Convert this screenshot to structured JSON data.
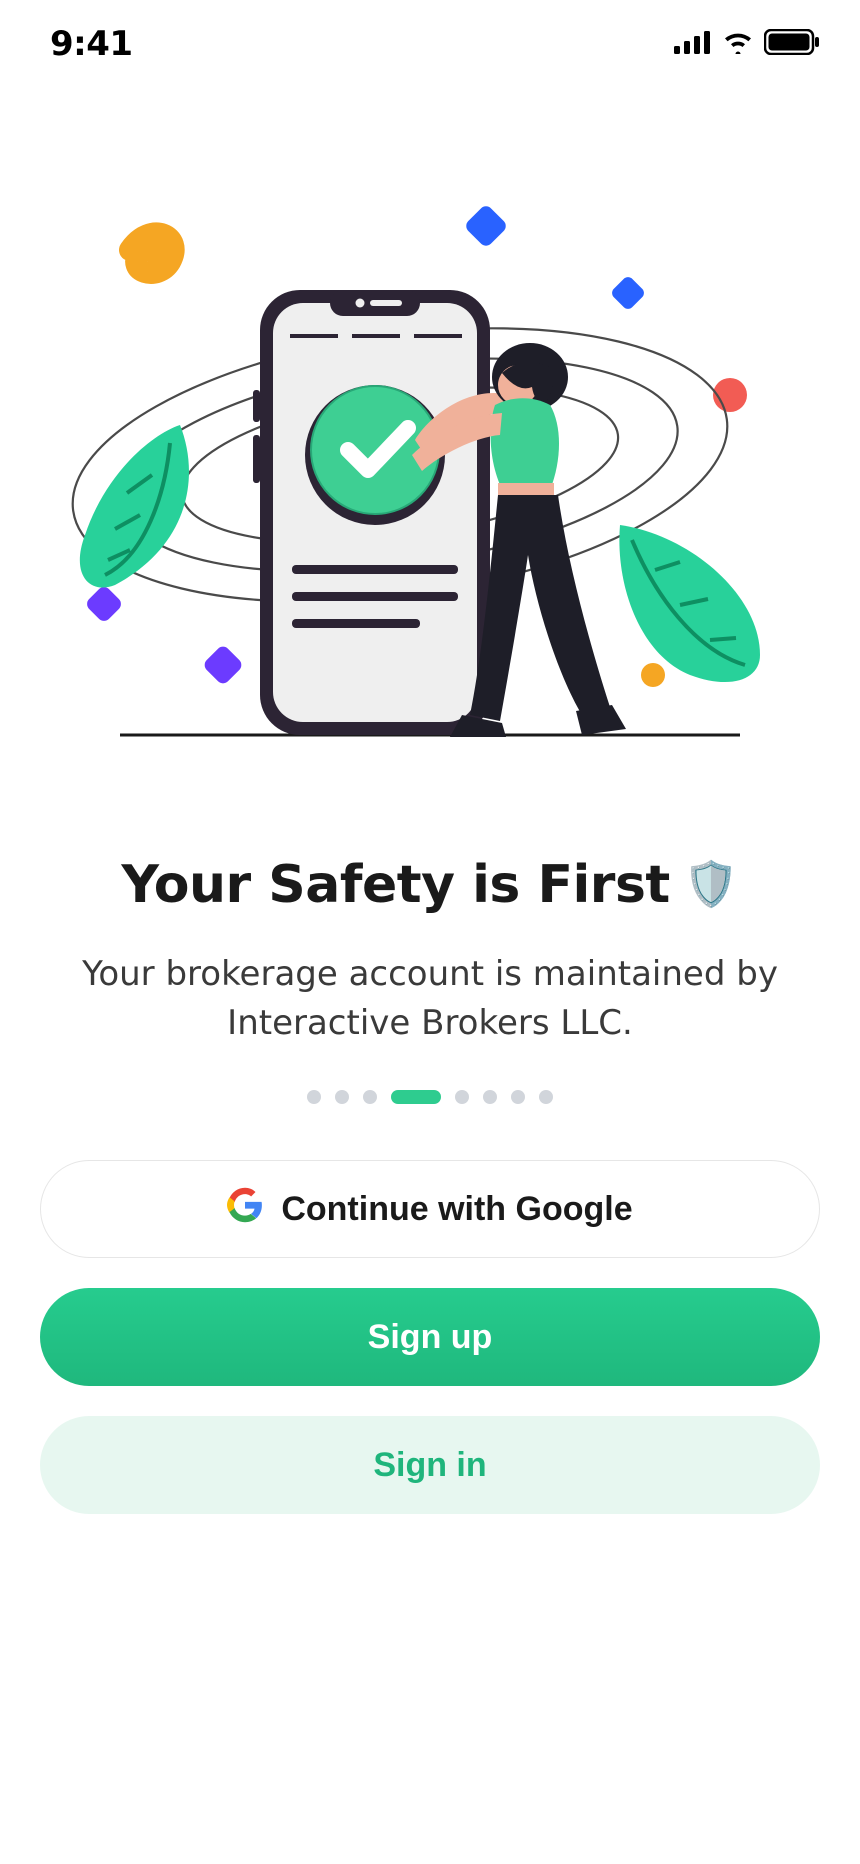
{
  "status": {
    "time": "9:41"
  },
  "headline": {
    "text": "Your Safety is First",
    "emoji": "🛡️"
  },
  "subtitle": "Your brokerage account is maintained by Interactive Brokers LLC.",
  "pager": {
    "count": 8,
    "active_index": 3
  },
  "buttons": {
    "google": "Continue with Google",
    "signup": "Sign up",
    "signin": "Sign in"
  },
  "colors": {
    "accent": "#1fba7f",
    "accent_light": "#e7f7f0",
    "dot_inactive": "#d1d5db"
  }
}
